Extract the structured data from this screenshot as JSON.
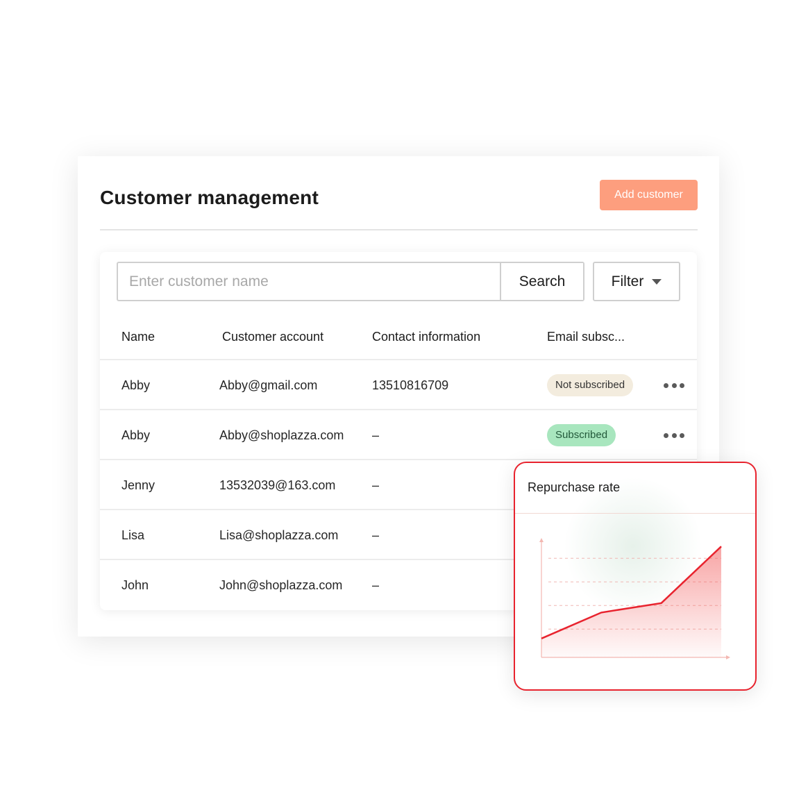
{
  "page": {
    "title": "Customer management",
    "add_button": "Add customer"
  },
  "search": {
    "placeholder": "Enter customer name",
    "button": "Search",
    "filter": "Filter"
  },
  "table": {
    "headers": [
      "Name",
      "Customer account",
      "Contact information",
      "Email subsc..."
    ],
    "rows": [
      {
        "name": "Abby",
        "account": "Abby@gmail.com",
        "contact": "13510816709",
        "subscription": "Not subscribed"
      },
      {
        "name": "Abby",
        "account": "Abby@shoplazza.com",
        "contact": "–",
        "subscription": "Subscribed"
      },
      {
        "name": "Jenny",
        "account": "13532039@163.com",
        "contact": "–",
        "subscription": ""
      },
      {
        "name": "Lisa",
        "account": "Lisa@shoplazza.com",
        "contact": "–",
        "subscription": ""
      },
      {
        "name": "John",
        "account": "John@shoplazza.com",
        "contact": "–",
        "subscription": ""
      }
    ]
  },
  "colors": {
    "accent": "#fd9e7e",
    "chart_line": "#e8232e",
    "subscribed_bg": "#a8e6be",
    "not_subscribed_bg": "#f3ecde"
  },
  "chart_data": {
    "type": "area",
    "title": "Repurchase rate",
    "x": [
      0,
      1,
      2,
      3
    ],
    "values": [
      0.8,
      1.9,
      2.3,
      4.7
    ],
    "xlabel": "",
    "ylabel": "",
    "ylim": [
      0,
      5
    ],
    "grid": true
  }
}
